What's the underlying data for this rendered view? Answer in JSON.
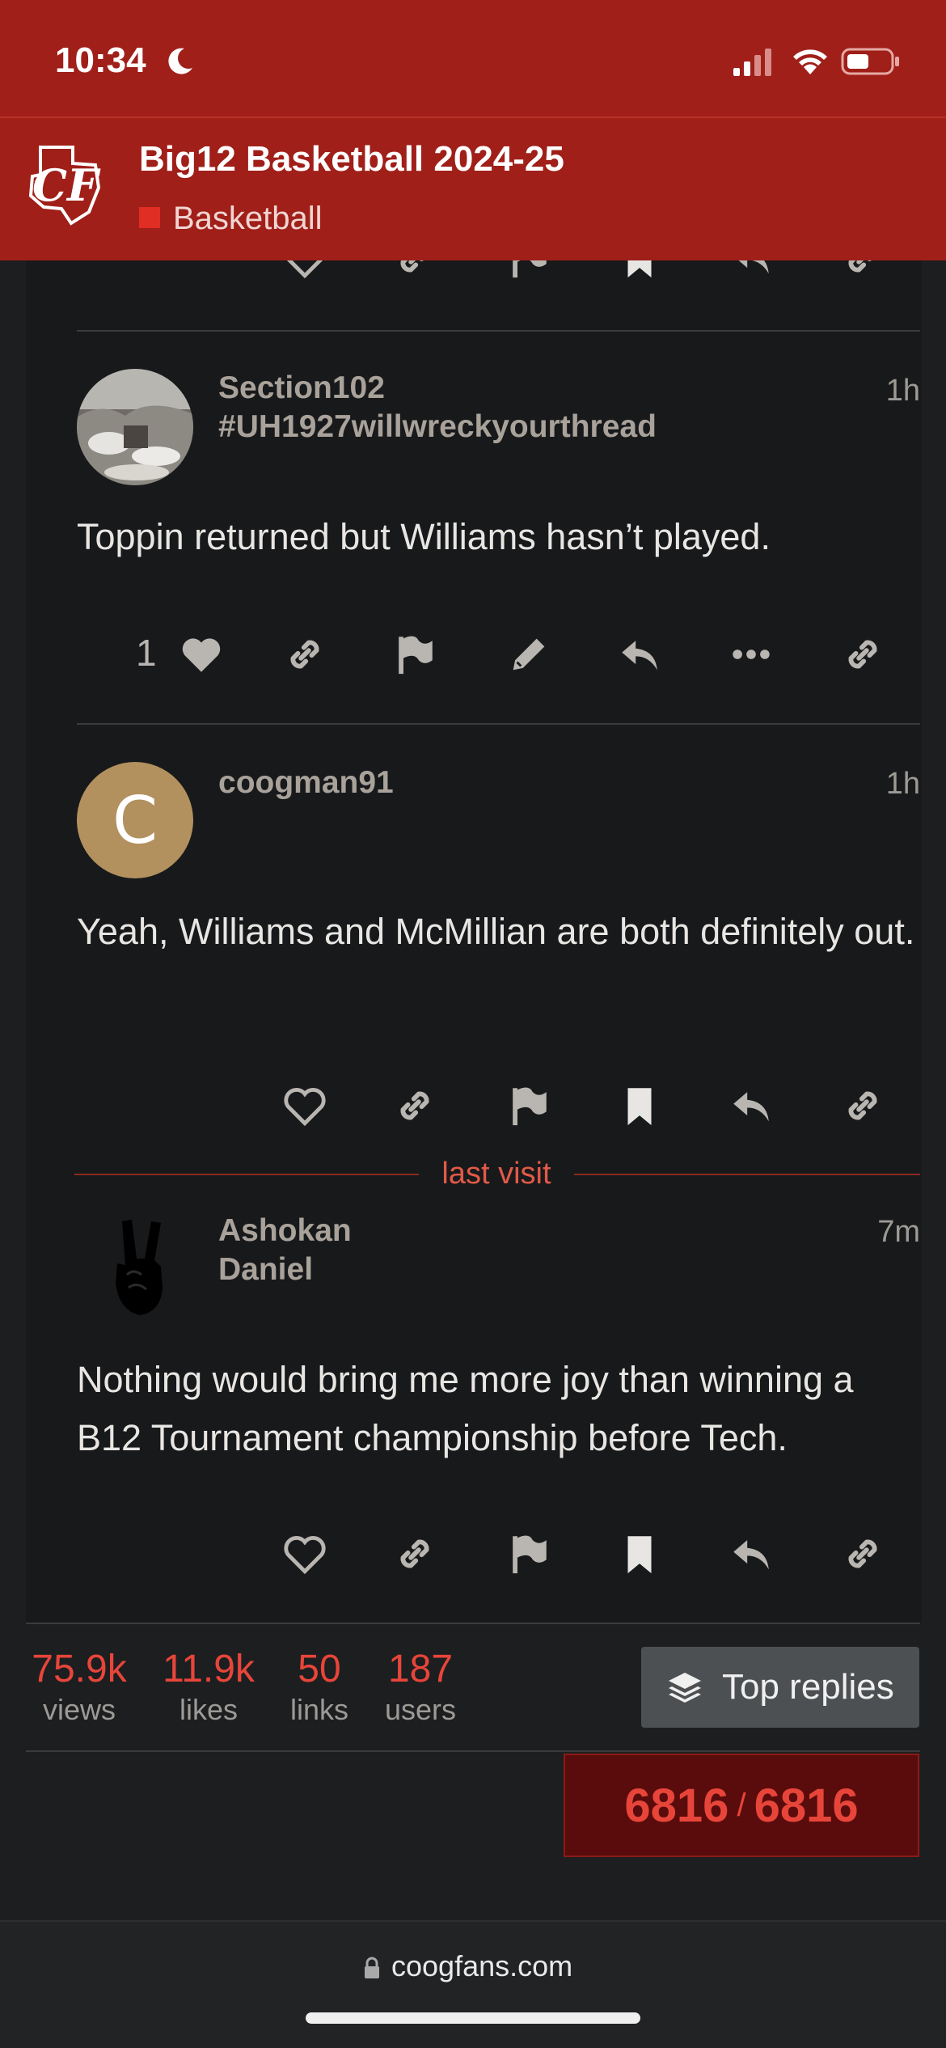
{
  "status_bar": {
    "time": "10:34"
  },
  "header": {
    "title": "Big12 Basketball 2024-25",
    "category": "Basketball",
    "category_color": "#e02e24",
    "logo_text": "CF"
  },
  "posts": [
    {
      "username": "Section102",
      "user_title": "#UH1927willwreckyourthread",
      "time": "1h",
      "body": "Toppin returned but Williams hasn’t played.",
      "likes": "1",
      "actions": [
        "like",
        "copy-link",
        "flag",
        "edit",
        "reply",
        "more",
        "share-link"
      ]
    },
    {
      "username": "coogman91",
      "avatar_letter": "C",
      "avatar_color": "#b2915f",
      "time": "1h",
      "body": "Yeah, Williams and McMillian are both definitely out.",
      "actions": [
        "like",
        "copy-link",
        "flag",
        "bookmark",
        "reply",
        "share-link"
      ]
    },
    {
      "username_line1": "Ashokan",
      "username_line2": "Daniel",
      "time": "7m",
      "body": "Nothing would bring me more joy than winning a B12 Tournament championship before Tech.",
      "actions": [
        "like",
        "copy-link",
        "flag",
        "bookmark",
        "reply",
        "share-link"
      ]
    }
  ],
  "last_visit_label": "last visit",
  "stats": [
    {
      "value": "75.9k",
      "label": "views"
    },
    {
      "value": "11.9k",
      "label": "likes"
    },
    {
      "value": "50",
      "label": "links"
    },
    {
      "value": "187",
      "label": "users"
    }
  ],
  "top_replies_label": "Top replies",
  "progress": {
    "current": "6816",
    "total": "6816"
  },
  "browser": {
    "url": "coogfans.com"
  },
  "colors": {
    "header_bg": "#a01f19",
    "accent": "#e8453a",
    "background": "#18191b"
  }
}
